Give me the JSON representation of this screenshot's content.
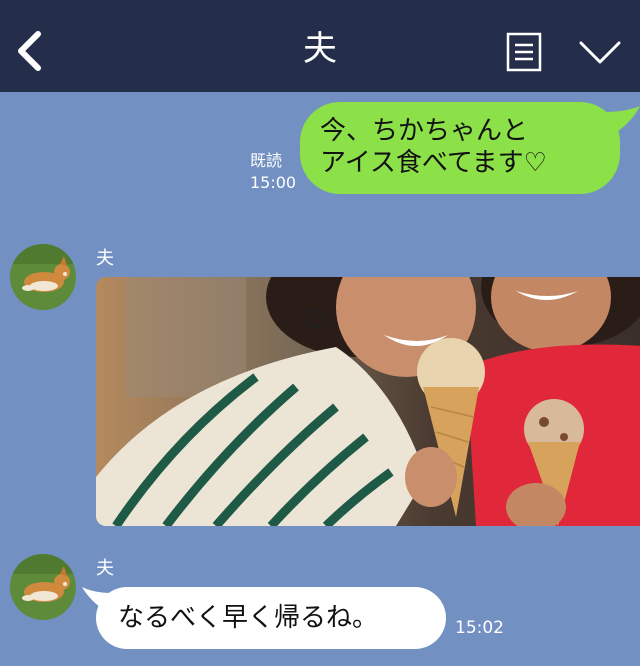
{
  "header": {
    "title": "夫",
    "back_icon": "chevron-left-icon",
    "notes_icon": "notes-icon",
    "dropdown_icon": "chevron-down-icon",
    "background": "#242e4b"
  },
  "chat": {
    "background": "#7290c2",
    "messages": [
      {
        "from": "me",
        "text_line1": "今、ちかちゃんと",
        "text_line2": "アイス食べてます♡",
        "read_label": "既読",
        "time": "15:00",
        "bubble_color": "#8ce048"
      },
      {
        "from": "other",
        "sender": "夫",
        "type": "photo",
        "photo": "two-women-eating-ice-cream-image"
      },
      {
        "from": "other",
        "sender": "夫",
        "text": "なるべく早く帰るね。",
        "time": "15:02",
        "bubble_color": "#ffffff"
      }
    ]
  }
}
